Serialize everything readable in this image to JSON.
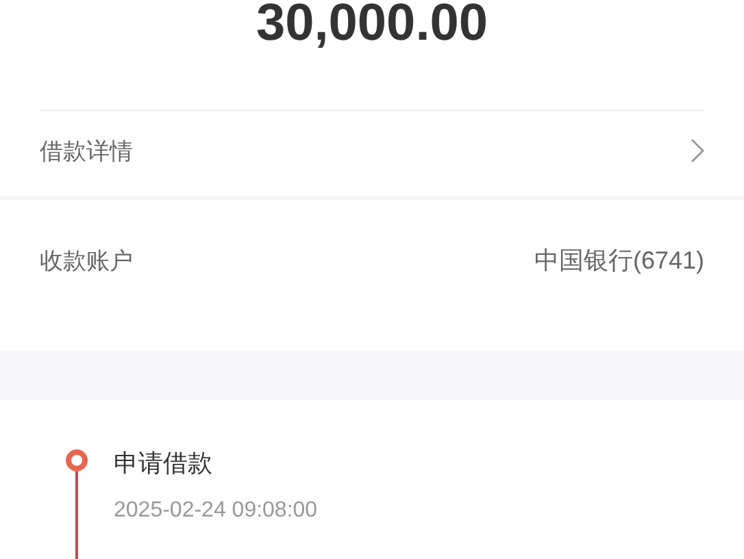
{
  "amount": "30,000.00",
  "detail_row": {
    "label": "借款详情"
  },
  "account_row": {
    "label": "收款账户",
    "value": "中国银行(6741)"
  },
  "timeline": [
    {
      "title": "申请借款",
      "time": "2025-02-24 09:08:00",
      "kind": "current"
    }
  ]
}
